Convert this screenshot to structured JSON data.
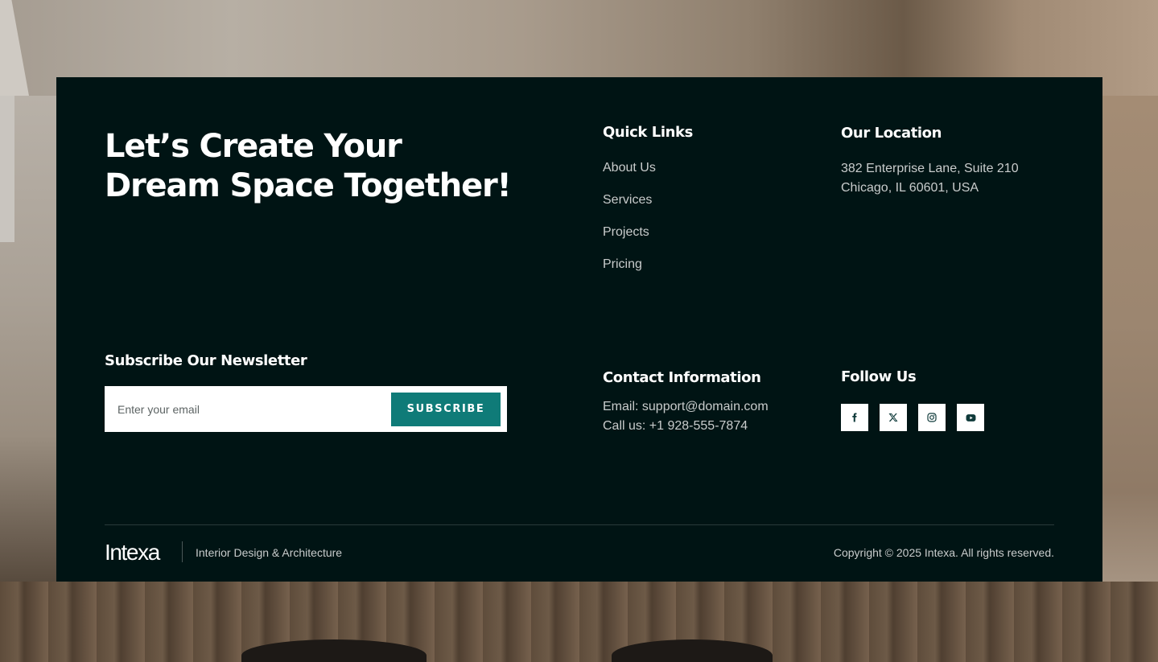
{
  "headline": {
    "line1": "Let’s Create Your",
    "line2": "Dream Space Together!"
  },
  "quick_links": {
    "title": "Quick Links",
    "items": [
      {
        "label": "About Us"
      },
      {
        "label": "Services"
      },
      {
        "label": "Projects"
      },
      {
        "label": "Pricing"
      }
    ]
  },
  "location": {
    "title": "Our Location",
    "line1": "382 Enterprise Lane, Suite 210",
    "line2": "Chicago, IL 60601, USA"
  },
  "newsletter": {
    "title": "Subscribe Our Newsletter",
    "placeholder": "Enter your email",
    "button_label": "SUBSCRIBE"
  },
  "contact": {
    "title": "Contact Information",
    "email": "Email: support@domain.com",
    "phone": "Call us: +1 928-555-7874"
  },
  "follow": {
    "title": "Follow Us",
    "icons": [
      "facebook-icon",
      "x-twitter-icon",
      "instagram-icon",
      "youtube-icon"
    ]
  },
  "bottom": {
    "logo": "Intexa",
    "tagline": "Interior Design & Architecture",
    "copyright": "Copyright © 2025 Intexa. All rights reserved."
  },
  "colors": {
    "footer_bg": "#001414",
    "accent": "#0f7b78",
    "muted_text": "#c9cccc"
  }
}
